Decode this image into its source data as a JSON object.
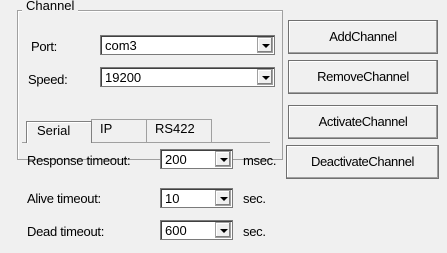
{
  "channel": {
    "title": "Channel",
    "port": {
      "label": "Port:",
      "value": "com3"
    },
    "speed": {
      "label": "Speed:",
      "value": "19200"
    },
    "tabs": [
      "Serial",
      "IP",
      "RS422"
    ],
    "active_tab": "Serial"
  },
  "buttons": {
    "add": "AddChannel",
    "remove": "RemoveChannel",
    "activate": "ActivateChannel",
    "deactivate": "DeactivateChannel"
  },
  "timeouts": {
    "response": {
      "label": "Response timeout:",
      "value": "200",
      "unit": "msec."
    },
    "alive": {
      "label": "Alive timeout:",
      "value": "10",
      "unit": "sec."
    },
    "dead": {
      "label": "Dead timeout:",
      "value": "600",
      "unit": "sec."
    }
  }
}
